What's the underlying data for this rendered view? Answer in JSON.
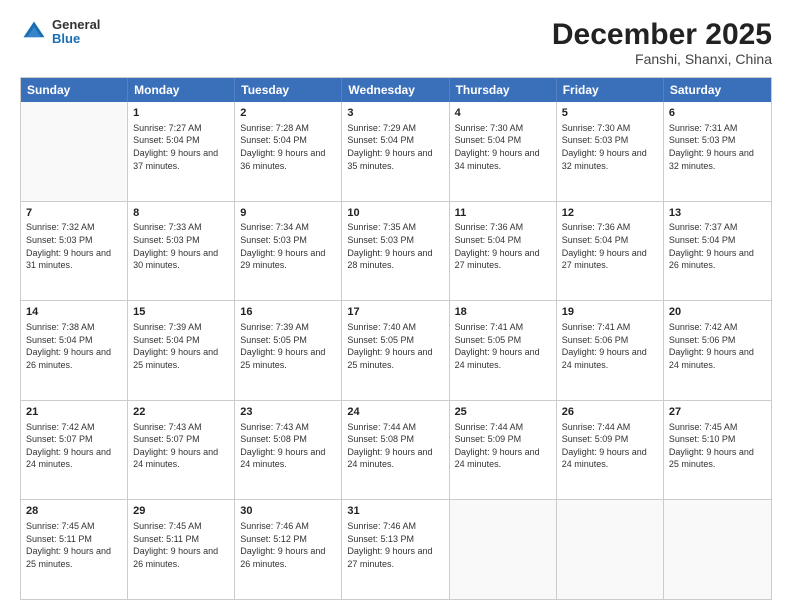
{
  "header": {
    "logo_general": "General",
    "logo_blue": "Blue",
    "month_title": "December 2025",
    "subtitle": "Fanshi, Shanxi, China"
  },
  "calendar": {
    "days_of_week": [
      "Sunday",
      "Monday",
      "Tuesday",
      "Wednesday",
      "Thursday",
      "Friday",
      "Saturday"
    ],
    "rows": [
      [
        {
          "day": "",
          "sunrise": "",
          "sunset": "",
          "daylight": ""
        },
        {
          "day": "1",
          "sunrise": "Sunrise: 7:27 AM",
          "sunset": "Sunset: 5:04 PM",
          "daylight": "Daylight: 9 hours and 37 minutes."
        },
        {
          "day": "2",
          "sunrise": "Sunrise: 7:28 AM",
          "sunset": "Sunset: 5:04 PM",
          "daylight": "Daylight: 9 hours and 36 minutes."
        },
        {
          "day": "3",
          "sunrise": "Sunrise: 7:29 AM",
          "sunset": "Sunset: 5:04 PM",
          "daylight": "Daylight: 9 hours and 35 minutes."
        },
        {
          "day": "4",
          "sunrise": "Sunrise: 7:30 AM",
          "sunset": "Sunset: 5:04 PM",
          "daylight": "Daylight: 9 hours and 34 minutes."
        },
        {
          "day": "5",
          "sunrise": "Sunrise: 7:30 AM",
          "sunset": "Sunset: 5:03 PM",
          "daylight": "Daylight: 9 hours and 32 minutes."
        },
        {
          "day": "6",
          "sunrise": "Sunrise: 7:31 AM",
          "sunset": "Sunset: 5:03 PM",
          "daylight": "Daylight: 9 hours and 32 minutes."
        }
      ],
      [
        {
          "day": "7",
          "sunrise": "Sunrise: 7:32 AM",
          "sunset": "Sunset: 5:03 PM",
          "daylight": "Daylight: 9 hours and 31 minutes."
        },
        {
          "day": "8",
          "sunrise": "Sunrise: 7:33 AM",
          "sunset": "Sunset: 5:03 PM",
          "daylight": "Daylight: 9 hours and 30 minutes."
        },
        {
          "day": "9",
          "sunrise": "Sunrise: 7:34 AM",
          "sunset": "Sunset: 5:03 PM",
          "daylight": "Daylight: 9 hours and 29 minutes."
        },
        {
          "day": "10",
          "sunrise": "Sunrise: 7:35 AM",
          "sunset": "Sunset: 5:03 PM",
          "daylight": "Daylight: 9 hours and 28 minutes."
        },
        {
          "day": "11",
          "sunrise": "Sunrise: 7:36 AM",
          "sunset": "Sunset: 5:04 PM",
          "daylight": "Daylight: 9 hours and 27 minutes."
        },
        {
          "day": "12",
          "sunrise": "Sunrise: 7:36 AM",
          "sunset": "Sunset: 5:04 PM",
          "daylight": "Daylight: 9 hours and 27 minutes."
        },
        {
          "day": "13",
          "sunrise": "Sunrise: 7:37 AM",
          "sunset": "Sunset: 5:04 PM",
          "daylight": "Daylight: 9 hours and 26 minutes."
        }
      ],
      [
        {
          "day": "14",
          "sunrise": "Sunrise: 7:38 AM",
          "sunset": "Sunset: 5:04 PM",
          "daylight": "Daylight: 9 hours and 26 minutes."
        },
        {
          "day": "15",
          "sunrise": "Sunrise: 7:39 AM",
          "sunset": "Sunset: 5:04 PM",
          "daylight": "Daylight: 9 hours and 25 minutes."
        },
        {
          "day": "16",
          "sunrise": "Sunrise: 7:39 AM",
          "sunset": "Sunset: 5:05 PM",
          "daylight": "Daylight: 9 hours and 25 minutes."
        },
        {
          "day": "17",
          "sunrise": "Sunrise: 7:40 AM",
          "sunset": "Sunset: 5:05 PM",
          "daylight": "Daylight: 9 hours and 25 minutes."
        },
        {
          "day": "18",
          "sunrise": "Sunrise: 7:41 AM",
          "sunset": "Sunset: 5:05 PM",
          "daylight": "Daylight: 9 hours and 24 minutes."
        },
        {
          "day": "19",
          "sunrise": "Sunrise: 7:41 AM",
          "sunset": "Sunset: 5:06 PM",
          "daylight": "Daylight: 9 hours and 24 minutes."
        },
        {
          "day": "20",
          "sunrise": "Sunrise: 7:42 AM",
          "sunset": "Sunset: 5:06 PM",
          "daylight": "Daylight: 9 hours and 24 minutes."
        }
      ],
      [
        {
          "day": "21",
          "sunrise": "Sunrise: 7:42 AM",
          "sunset": "Sunset: 5:07 PM",
          "daylight": "Daylight: 9 hours and 24 minutes."
        },
        {
          "day": "22",
          "sunrise": "Sunrise: 7:43 AM",
          "sunset": "Sunset: 5:07 PM",
          "daylight": "Daylight: 9 hours and 24 minutes."
        },
        {
          "day": "23",
          "sunrise": "Sunrise: 7:43 AM",
          "sunset": "Sunset: 5:08 PM",
          "daylight": "Daylight: 9 hours and 24 minutes."
        },
        {
          "day": "24",
          "sunrise": "Sunrise: 7:44 AM",
          "sunset": "Sunset: 5:08 PM",
          "daylight": "Daylight: 9 hours and 24 minutes."
        },
        {
          "day": "25",
          "sunrise": "Sunrise: 7:44 AM",
          "sunset": "Sunset: 5:09 PM",
          "daylight": "Daylight: 9 hours and 24 minutes."
        },
        {
          "day": "26",
          "sunrise": "Sunrise: 7:44 AM",
          "sunset": "Sunset: 5:09 PM",
          "daylight": "Daylight: 9 hours and 24 minutes."
        },
        {
          "day": "27",
          "sunrise": "Sunrise: 7:45 AM",
          "sunset": "Sunset: 5:10 PM",
          "daylight": "Daylight: 9 hours and 25 minutes."
        }
      ],
      [
        {
          "day": "28",
          "sunrise": "Sunrise: 7:45 AM",
          "sunset": "Sunset: 5:11 PM",
          "daylight": "Daylight: 9 hours and 25 minutes."
        },
        {
          "day": "29",
          "sunrise": "Sunrise: 7:45 AM",
          "sunset": "Sunset: 5:11 PM",
          "daylight": "Daylight: 9 hours and 26 minutes."
        },
        {
          "day": "30",
          "sunrise": "Sunrise: 7:46 AM",
          "sunset": "Sunset: 5:12 PM",
          "daylight": "Daylight: 9 hours and 26 minutes."
        },
        {
          "day": "31",
          "sunrise": "Sunrise: 7:46 AM",
          "sunset": "Sunset: 5:13 PM",
          "daylight": "Daylight: 9 hours and 27 minutes."
        },
        {
          "day": "",
          "sunrise": "",
          "sunset": "",
          "daylight": ""
        },
        {
          "day": "",
          "sunrise": "",
          "sunset": "",
          "daylight": ""
        },
        {
          "day": "",
          "sunrise": "",
          "sunset": "",
          "daylight": ""
        }
      ]
    ]
  }
}
